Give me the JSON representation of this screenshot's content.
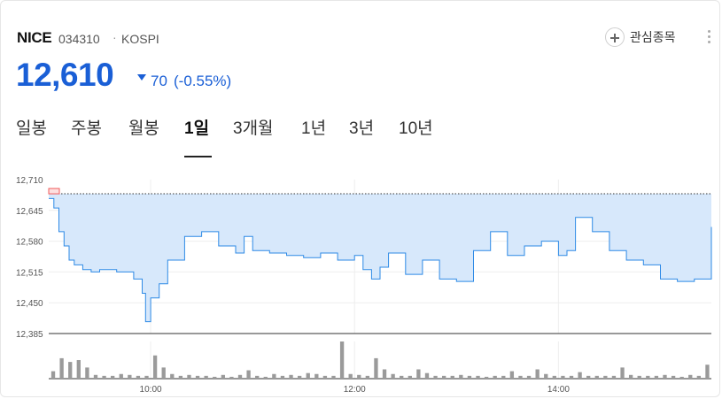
{
  "stock": {
    "name": "NICE",
    "code": "034310",
    "separator": "·",
    "market": "KOSPI",
    "price": "12,610",
    "change": "70",
    "change_pct": "(-0.55%)",
    "direction": "down"
  },
  "actions": {
    "watchlist_label": "관심종목",
    "watchlist_icon": "plus-circle-icon",
    "more_icon": "more-vertical-icon"
  },
  "tabs": [
    "일봉",
    "주봉",
    "월봉",
    "1일",
    "3개월",
    "1년",
    "3년",
    "10년"
  ],
  "active_tab": "1일",
  "colors": {
    "price": "#1a5fd6",
    "line": "#2e8ae6",
    "fill": "#d7e8fb",
    "volume": "#9a9a9a",
    "prev_close_line": "#333333",
    "open_marker": "#f15b5b"
  },
  "chart_data": {
    "type": "line",
    "y_ticks": [
      "12,710",
      "12,645",
      "12,580",
      "12,515",
      "12,450",
      "12,385"
    ],
    "ylim": [
      12385,
      12710
    ],
    "x_ticks": [
      "10:00",
      "12:00",
      "14:00"
    ],
    "x_range": [
      "09:00",
      "15:30"
    ],
    "prev_close": 12680,
    "series": [
      {
        "x": [
          "09:00",
          "09:03",
          "09:06",
          "09:09",
          "09:12",
          "09:15",
          "09:20",
          "09:25",
          "09:30",
          "09:40",
          "09:50",
          "09:55",
          "09:57",
          "10:00",
          "10:05",
          "10:10",
          "10:20",
          "10:30",
          "10:40",
          "10:50",
          "10:55",
          "11:00",
          "11:10",
          "11:20",
          "11:30",
          "11:40",
          "11:50",
          "12:00",
          "12:05",
          "12:10",
          "12:15",
          "12:20",
          "12:30",
          "12:40",
          "12:50",
          "13:00",
          "13:10",
          "13:20",
          "13:30",
          "13:40",
          "13:50",
          "14:00",
          "14:05",
          "14:10",
          "14:20",
          "14:30",
          "14:40",
          "14:50",
          "15:00",
          "15:10",
          "15:20",
          "15:30"
        ],
        "y": [
          12670,
          12650,
          12600,
          12570,
          12540,
          12530,
          12520,
          12515,
          12520,
          12515,
          12500,
          12470,
          12410,
          12460,
          12490,
          12540,
          12590,
          12600,
          12570,
          12555,
          12590,
          12560,
          12555,
          12550,
          12545,
          12555,
          12540,
          12550,
          12520,
          12500,
          12525,
          12555,
          12510,
          12540,
          12500,
          12495,
          12560,
          12600,
          12550,
          12570,
          12580,
          12550,
          12560,
          12630,
          12600,
          12560,
          12540,
          12530,
          12500,
          12495,
          12500,
          12610
        ]
      }
    ],
    "volume": [
      8,
      22,
      18,
      20,
      12,
      4,
      3,
      3,
      5,
      4,
      3,
      3,
      25,
      12,
      5,
      3,
      4,
      3,
      3,
      2,
      4,
      2,
      4,
      9,
      3,
      2,
      5,
      3,
      4,
      3,
      6,
      5,
      3,
      3,
      40,
      5,
      4,
      3,
      22,
      10,
      5,
      3,
      3,
      10,
      6,
      3,
      3,
      3,
      4,
      3,
      3,
      2,
      3,
      3,
      8,
      3,
      3,
      10,
      5,
      3,
      3,
      3,
      7,
      3,
      3,
      3,
      3,
      12,
      4,
      3,
      3,
      3,
      4,
      3,
      2,
      4,
      3,
      15
    ]
  }
}
